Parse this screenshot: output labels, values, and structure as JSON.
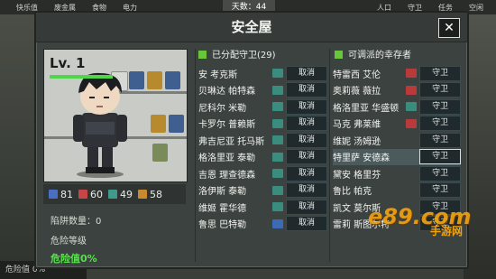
{
  "hud": {
    "items": [
      "快乐值",
      "废金属",
      "食物",
      "电力"
    ],
    "days": "天数：44",
    "right_items": [
      "人口",
      "守卫",
      "任务",
      "空闲"
    ]
  },
  "bottom_left": "危险值 0%",
  "modal": {
    "title": "安全屋",
    "close": "✕"
  },
  "character": {
    "level": "Lv. 1",
    "stats": [
      {
        "value": "81",
        "color": "#4a6fc2"
      },
      {
        "value": "60",
        "color": "#c84545"
      },
      {
        "value": "49",
        "color": "#3f9a8b"
      },
      {
        "value": "58",
        "color": "#c9892e"
      }
    ],
    "traps_label": "陷阱数量：0",
    "danger_level_label": "危险等级",
    "danger_value": "危险值0%"
  },
  "assigned": {
    "header": "已分配守卫(29)",
    "button_label": "取消",
    "rows": [
      {
        "name": "安 考克斯",
        "icon": "#3a8c7e"
      },
      {
        "name": "贝琳达 帕特森",
        "icon": "#3a8c7e"
      },
      {
        "name": "尼科尔 米勒",
        "icon": "#3a8c7e"
      },
      {
        "name": "卡罗尔 普赖斯",
        "icon": "#3a8c7e"
      },
      {
        "name": "弗吉尼亚 托马斯",
        "icon": "#3a8c7e"
      },
      {
        "name": "格洛里亚 泰勒",
        "icon": "#3a8c7e"
      },
      {
        "name": "吉恩 理查德森",
        "icon": "#3a8c7e"
      },
      {
        "name": "洛伊斯 泰勒",
        "icon": "#3a8c7e"
      },
      {
        "name": "维姬 霍华德",
        "icon": "#3a8c7e"
      },
      {
        "name": "鲁思 巴特勒",
        "icon": "#3d6ab4"
      }
    ]
  },
  "available": {
    "header": "可调派的幸存者",
    "button_label": "守卫",
    "rows": [
      {
        "name": "特雷西 艾伦",
        "icon": "#b83a3a"
      },
      {
        "name": "奥莉薇 薇拉",
        "icon": "#b83a3a"
      },
      {
        "name": "格洛里亚 华盛顿",
        "icon": "#3a8c7e"
      },
      {
        "name": "马克 弗莱维",
        "icon": "#b83a3a"
      },
      {
        "name": "维妮 汤姆逊",
        "icon": ""
      },
      {
        "name": "特里萨 安德森",
        "icon": "",
        "selected": true
      },
      {
        "name": "黛安 格里芬",
        "icon": ""
      },
      {
        "name": "鲁比 帕克",
        "icon": ""
      },
      {
        "name": "凯文 莫尔斯",
        "icon": ""
      },
      {
        "name": "雷莉 斯图尔特",
        "icon": ""
      }
    ]
  },
  "watermark": {
    "logo": "e89.com",
    "sub": "手游网"
  }
}
